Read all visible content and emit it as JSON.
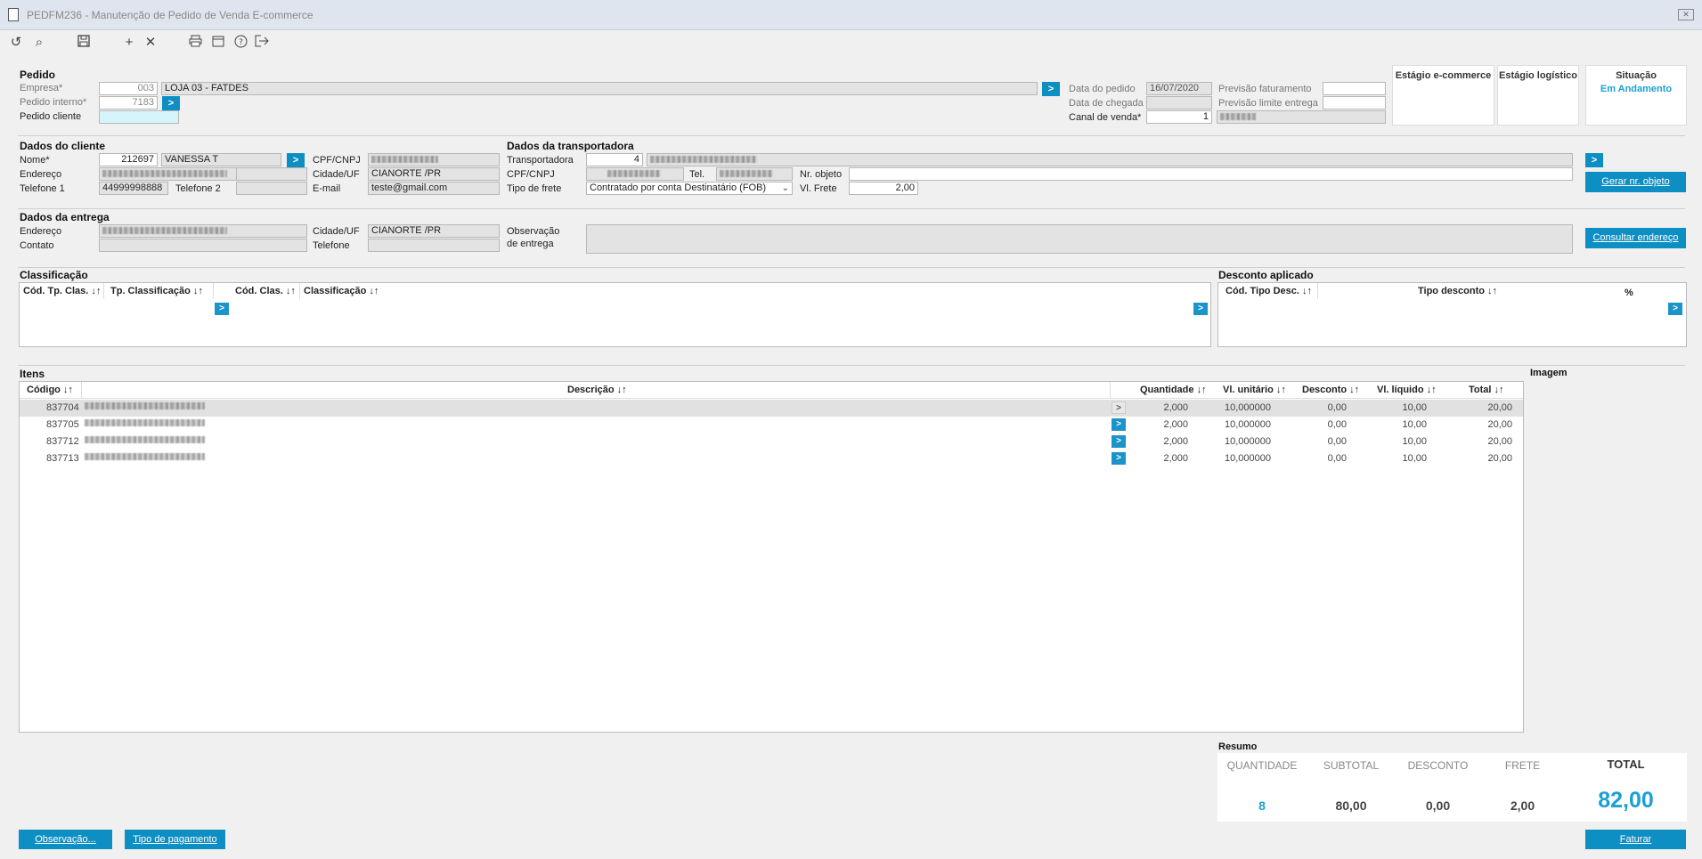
{
  "window": {
    "title": "PEDFM236 - Manutenção de Pedido de Venda E-commerce"
  },
  "toolbar": {
    "icons": [
      "undo-icon",
      "search-icon",
      "save-icon",
      "add-icon",
      "delete-icon",
      "print-icon",
      "calendar-icon",
      "help-icon",
      "exit-icon"
    ]
  },
  "pedido": {
    "title": "Pedido",
    "empresa_label": "Empresa*",
    "empresa_code": "003",
    "empresa_name": "LOJA 03 - FATDES",
    "interno_label": "Pedido interno*",
    "interno_value": "7183",
    "cliente_label": "Pedido cliente",
    "cliente_value": "",
    "data_pedido_label": "Data do pedido",
    "data_pedido_value": "16/07/2020",
    "data_chegada_label": "Data de chegada",
    "data_chegada_value": "",
    "canal_label": "Canal de venda*",
    "canal_value": "1",
    "prev_fat_label": "Previsão faturamento",
    "prev_fat_value": "",
    "prev_lim_label": "Previsão limite entrega",
    "prev_lim_value": ""
  },
  "status": {
    "ecommerce_label": "Estágio e-commerce",
    "logistico_label": "Estágio logístico",
    "situacao_label": "Situação",
    "situacao_value": "Em Andamento"
  },
  "cliente": {
    "title": "Dados do cliente",
    "nome_label": "Nome*",
    "nome_code": "212697",
    "nome_value": "VANESSA T",
    "endereco_label": "Endereço",
    "telefone1_label": "Telefone 1",
    "telefone1_value": "44999998888",
    "telefone2_label": "Telefone 2",
    "telefone2_value": "",
    "cpf_label": "CPF/CNPJ",
    "cidade_label": "Cidade/UF",
    "cidade_value": "CIANORTE /PR",
    "email_label": "E-mail",
    "email_value": "teste@gmail.com"
  },
  "transportadora": {
    "title": "Dados da transportadora",
    "transp_label": "Transportadora",
    "transp_code": "4",
    "cpf_label": "CPF/CNPJ",
    "tel_label": "Tel.",
    "nr_objeto_label": "Nr. objeto",
    "nr_objeto_value": "",
    "frete_tipo_label": "Tipo de frete",
    "frete_tipo_value": "Contratado por conta Destinatário (FOB)",
    "vl_frete_label": "Vl. Frete",
    "vl_frete_value": "2,00",
    "gerar_btn": "Gerar nr. objeto"
  },
  "entrega": {
    "title": "Dados da entrega",
    "endereco_label": "Endereço",
    "contato_label": "Contato",
    "cidade_label": "Cidade/UF",
    "cidade_value": "CIANORTE /PR",
    "telefone_label": "Telefone",
    "obs_label1": "Observação",
    "obs_label2": "de entrega",
    "consultar_btn": "Consultar endereço"
  },
  "classificacao": {
    "title": "Classificação",
    "columns": [
      "Cód. Tp. Clas. ↓↑",
      "Tp. Classificação ↓↑",
      "Cód. Clas. ↓↑",
      "Classificação ↓↑"
    ]
  },
  "desconto": {
    "title": "Desconto aplicado",
    "columns": [
      "Cód. Tipo Desc. ↓↑",
      "Tipo desconto ↓↑",
      "%"
    ]
  },
  "itens": {
    "title": "Itens",
    "imagem_label": "Imagem",
    "columns": [
      "Código ↓↑",
      "Descrição ↓↑",
      "Quantidade ↓↑",
      "Vl. unitário ↓↑",
      "Desconto ↓↑",
      "Vl. líquido ↓↑",
      "Total ↓↑"
    ],
    "rows": [
      {
        "codigo": "837704",
        "quantidade": "2,000",
        "unitario": "10,000000",
        "desconto": "0,00",
        "liquido": "10,00",
        "total": "20,00"
      },
      {
        "codigo": "837705",
        "quantidade": "2,000",
        "unitario": "10,000000",
        "desconto": "0,00",
        "liquido": "10,00",
        "total": "20,00"
      },
      {
        "codigo": "837712",
        "quantidade": "2,000",
        "unitario": "10,000000",
        "desconto": "0,00",
        "liquido": "10,00",
        "total": "20,00"
      },
      {
        "codigo": "837713",
        "quantidade": "2,000",
        "unitario": "10,000000",
        "desconto": "0,00",
        "liquido": "10,00",
        "total": "20,00"
      }
    ]
  },
  "resumo": {
    "title": "Resumo",
    "quantidade_label": "QUANTIDADE",
    "quantidade_value": "8",
    "subtotal_label": "SUBTOTAL",
    "subtotal_value": "80,00",
    "desconto_label": "DESCONTO",
    "desconto_value": "0,00",
    "frete_label": "FRETE",
    "frete_value": "2,00",
    "total_label": "TOTAL",
    "total_value": "82,00"
  },
  "footer": {
    "observacao_btn": "Observação...",
    "pagamento_btn": "Tipo de pagamento",
    "faturar_btn": "Faturar"
  },
  "colors": {
    "accent": "#0e8fc4",
    "situacao": "#1aa0d6"
  }
}
